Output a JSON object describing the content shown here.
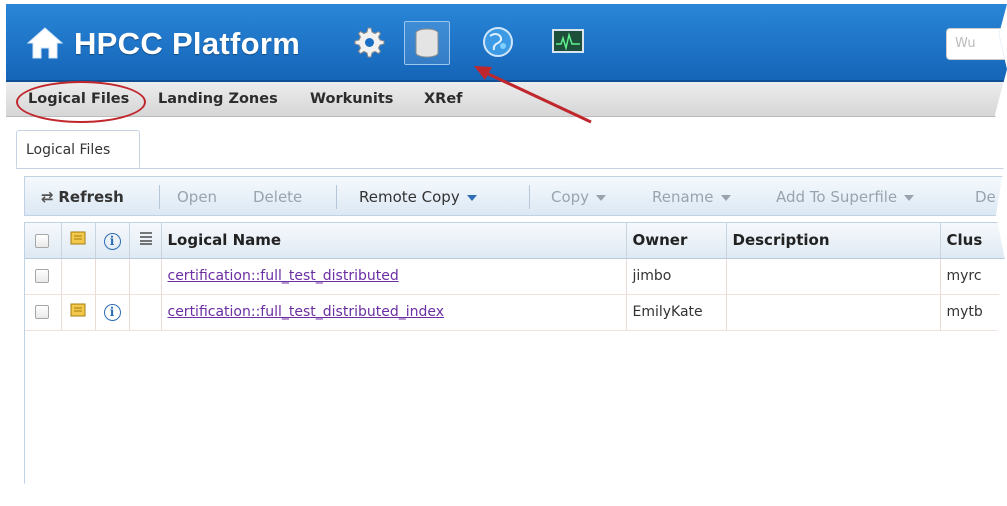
{
  "header": {
    "title": "HPCC Platform",
    "search_placeholder": "Wu",
    "icons": [
      "home-icon",
      "gear-icon",
      "database-icon",
      "globe-icon",
      "monitor-icon"
    ]
  },
  "menu": {
    "items": [
      "Logical Files",
      "Landing Zones",
      "Workunits",
      "XRef"
    ]
  },
  "tab": {
    "label": "Logical Files"
  },
  "toolbar": {
    "refresh": "Refresh",
    "open": "Open",
    "delete": "Delete",
    "remote_copy": "Remote Copy",
    "copy": "Copy",
    "rename": "Rename",
    "add_to_superfile": "Add To Superfile",
    "more": "De"
  },
  "grid": {
    "columns": [
      "Logical Name",
      "Owner",
      "Description",
      "Clus"
    ],
    "rows": [
      {
        "name": "certification::full_test_distributed",
        "owner": "jimbo",
        "description": "",
        "cluster": "myrc"
      },
      {
        "name": "certification::full_test_distributed_index",
        "owner": "EmilyKate",
        "description": "",
        "cluster": "mytb"
      }
    ]
  },
  "colors": {
    "header": "#1a6fc4",
    "annotation": "#c0272d",
    "link": "#6b2ea3"
  }
}
